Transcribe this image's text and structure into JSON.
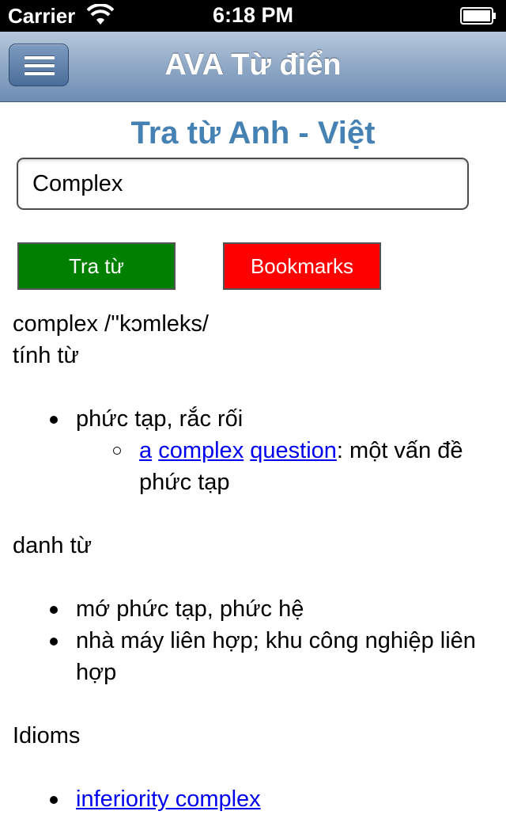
{
  "status_bar": {
    "carrier": "Carrier",
    "time": "6:18 PM"
  },
  "nav_bar": {
    "title": "AVA Từ điển",
    "menu_icon": "hamburger-icon"
  },
  "heading": "Tra từ Anh - Việt",
  "search": {
    "value": "Complex"
  },
  "buttons": {
    "lookup_label": "Tra từ",
    "bookmarks_label": "Bookmarks",
    "lookup_color": "#008000",
    "bookmarks_color": "#ff0000"
  },
  "result": {
    "headword": "complex /''kɔmleks/",
    "pos1": "tính từ",
    "adj_meaning": "phức tạp, rắc rối",
    "example_link1": "a",
    "example_link2": "complex",
    "example_link3": "question",
    "example_translation": ": một vấn đề phức tạp",
    "pos2": "danh từ",
    "noun_meaning1": "mớ phức tạp, phức hệ",
    "noun_meaning2": "nhà máy liên hợp; khu công nghiệp liên hợp",
    "idioms_label": "Idioms",
    "idiom_link": "inferiority complex"
  }
}
